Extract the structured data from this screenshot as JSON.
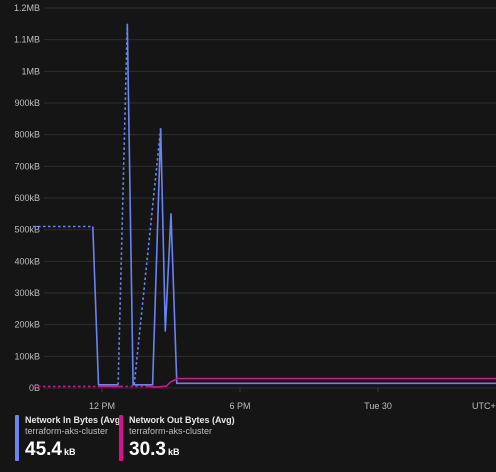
{
  "chart_data": {
    "type": "line",
    "y_ticks": [
      "0B",
      "100kB",
      "200kB",
      "300kB",
      "400kB",
      "500kB",
      "600kB",
      "700kB",
      "800kB",
      "900kB",
      "1MB",
      "1.1MB",
      "1.2MB"
    ],
    "x_ticks": [
      {
        "label": "12 PM",
        "hour": 0
      },
      {
        "label": "6 PM",
        "hour": 6
      },
      {
        "label": "Tue 30",
        "hour": 12
      },
      {
        "label": "UTC+0",
        "hour": 19.4
      }
    ],
    "ylim_kB": [
      0,
      1200
    ],
    "xlim_hours_from_12pm": [
      -3,
      19.4
    ],
    "grid": true,
    "series": [
      {
        "name": "Network In Bytes (Avg)",
        "resource": "terraform-aks-cluster",
        "color": "#6b84f0",
        "summary_value": "45.4",
        "summary_unit": "kB",
        "segments": [
          {
            "style": "dashed",
            "points": [
              [
                -3,
                510
              ],
              [
                -0.4,
                510
              ]
            ]
          },
          {
            "style": "solid",
            "points": [
              [
                -0.4,
                510
              ],
              [
                -0.15,
                10
              ],
              [
                0.7,
                10
              ]
            ]
          },
          {
            "style": "dashed",
            "points": [
              [
                0.7,
                10
              ],
              [
                1.1,
                1150
              ]
            ]
          },
          {
            "style": "solid",
            "points": [
              [
                1.1,
                1150
              ],
              [
                1.35,
                10
              ],
              [
                2.2,
                10
              ],
              [
                2.55,
                820
              ]
            ]
          },
          {
            "style": "dashed",
            "points": [
              [
                2.55,
                820
              ],
              [
                1.4,
                10
              ]
            ]
          },
          {
            "style": "solid",
            "points": [
              [
                2.55,
                820
              ],
              [
                2.75,
                180
              ],
              [
                3.0,
                550
              ],
              [
                3.25,
                15
              ],
              [
                19.4,
                15
              ]
            ]
          }
        ]
      },
      {
        "name": "Network Out Bytes (Avg)",
        "resource": "terraform-aks-cluster",
        "color": "#d6128c",
        "summary_value": "30.3",
        "summary_unit": "kB",
        "segments": [
          {
            "style": "dashed",
            "points": [
              [
                -3,
                5
              ],
              [
                -0.15,
                5
              ]
            ]
          },
          {
            "style": "solid",
            "points": [
              [
                -0.15,
                5
              ],
              [
                0.8,
                5
              ]
            ]
          },
          {
            "style": "dashed",
            "points": [
              [
                0.8,
                5
              ],
              [
                2.0,
                5
              ]
            ]
          },
          {
            "style": "solid",
            "points": [
              [
                2.0,
                5
              ],
              [
                2.4,
                3
              ],
              [
                2.8,
                6
              ],
              [
                3.0,
                20
              ],
              [
                3.3,
                30
              ],
              [
                19.4,
                30
              ]
            ]
          }
        ]
      }
    ]
  }
}
